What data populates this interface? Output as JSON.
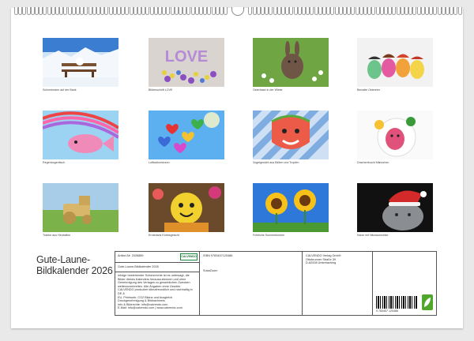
{
  "calendar": {
    "title_line1": "Gute-Laune-",
    "title_line2": "Bildkalender 2026"
  },
  "photos": [
    {
      "caption": "Schneemann auf der Bank",
      "icon": "snowman-bench"
    },
    {
      "caption": "Blütenschrift LOVE",
      "icon": "flower-love"
    },
    {
      "caption": "Osterhase in der Wiese",
      "icon": "easter-bunny"
    },
    {
      "caption": "Bemalte Ostereier",
      "icon": "painted-eggs"
    },
    {
      "caption": "Regenbogenfisch",
      "icon": "rainbow-fish"
    },
    {
      "caption": "Luftballonherzen",
      "icon": "balloon-hearts"
    },
    {
      "caption": "Vogelgesicht aus Blüten und Tropfen",
      "icon": "melon-face"
    },
    {
      "caption": "Drachenfrucht Männchen",
      "icon": "dragonfruit-man"
    },
    {
      "caption": "Traktor aus Heuballen",
      "icon": "hay-tractor"
    },
    {
      "caption": "Erntedank Kürbisgesicht",
      "icon": "pumpkin-face"
    },
    {
      "caption": "Fröhliche Sonnenblumen",
      "icon": "sunflowers"
    },
    {
      "caption": "Katze mit Nikolausmütze",
      "icon": "cat-santa-hat"
    }
  ],
  "info": {
    "article_no": "Artikel-Nr. 2026889",
    "product_name": "Gute-Laune-Bildkalender 2026",
    "logo_text": "CALVENDO",
    "description_lines": [
      "Infolge bestehender Schutzrechte ist es untersagt, die",
      "Bilder dieses Kalenders herauszutrennen und ohne",
      "Genehmigung des Verlages zu gewerblichen Zwecken",
      "weiterzuverbreiten. Alle Angaben ohne Gewähr.",
      "CALVENDO produziert klimafreundlich und nachhaltig in DE &",
      "EU. Printwork: CO2 Bilanz und Ausgleich",
      "Druckgenehmigung & Bildnachweis",
      "Info & Bildrechte: info@calvendo.com",
      "E-Mail: info@calvendo.com | www.calvendo.com"
    ],
    "isbn": "ISBN 9783457120486",
    "photographer": "SusaZoom",
    "publisher_lines": [
      "CALVENDO Verlag GmbH",
      "Ottobrunner Straße 39",
      "D-82008 Unterhaching"
    ],
    "barcode_digits": "9 783457 120486"
  },
  "colors": {
    "accent_green": "#4fa82b",
    "border": "#555555"
  }
}
